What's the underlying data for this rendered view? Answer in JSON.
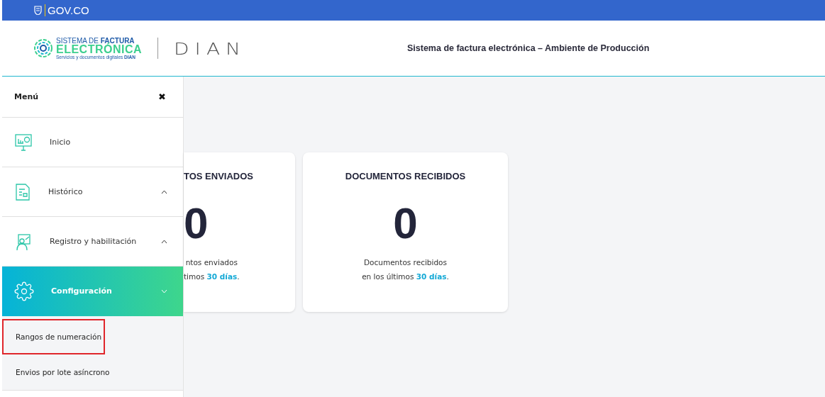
{
  "gov_bar": {
    "label": "GOV.CO"
  },
  "header": {
    "logo": {
      "line1": "SISTEMA DE **FACTURA**",
      "line2": "ELECTRÓNICA",
      "line3": "Servicios y documentos digitales **DIAN**"
    },
    "brand": "DIAN",
    "title": "Sistema de factura electrónica – Ambiente de Producción"
  },
  "menu": {
    "title": "Menú",
    "close": "✖",
    "items": [
      {
        "label": "Inicio",
        "kind": "link",
        "active": false
      },
      {
        "label": "Histórico",
        "kind": "group",
        "active": false,
        "expanded": false
      },
      {
        "label": "Registro y habilitación",
        "kind": "group",
        "active": false,
        "expanded": false
      },
      {
        "label": "Configuración",
        "kind": "group",
        "active": true,
        "expanded": true,
        "children": [
          {
            "label": "Rangos de numeración",
            "highlighted": true
          },
          {
            "label": "Envios por lote asíncrono",
            "highlighted": false
          }
        ]
      }
    ]
  },
  "cards": [
    {
      "title": "TOS ENVIADOS",
      "count": "0",
      "caption_line1": "ntos enviados",
      "caption_line2": "timos ",
      "caption_link": "30 días",
      "caption_end": ".",
      "clipped": true
    },
    {
      "title": "DOCUMENTOS RECIBIDOS",
      "count": "0",
      "caption_line1": "Documentos recibidos",
      "caption_line2": "en los últimos ",
      "caption_link": "30 días",
      "caption_end": ".",
      "clipped": false
    }
  ]
}
